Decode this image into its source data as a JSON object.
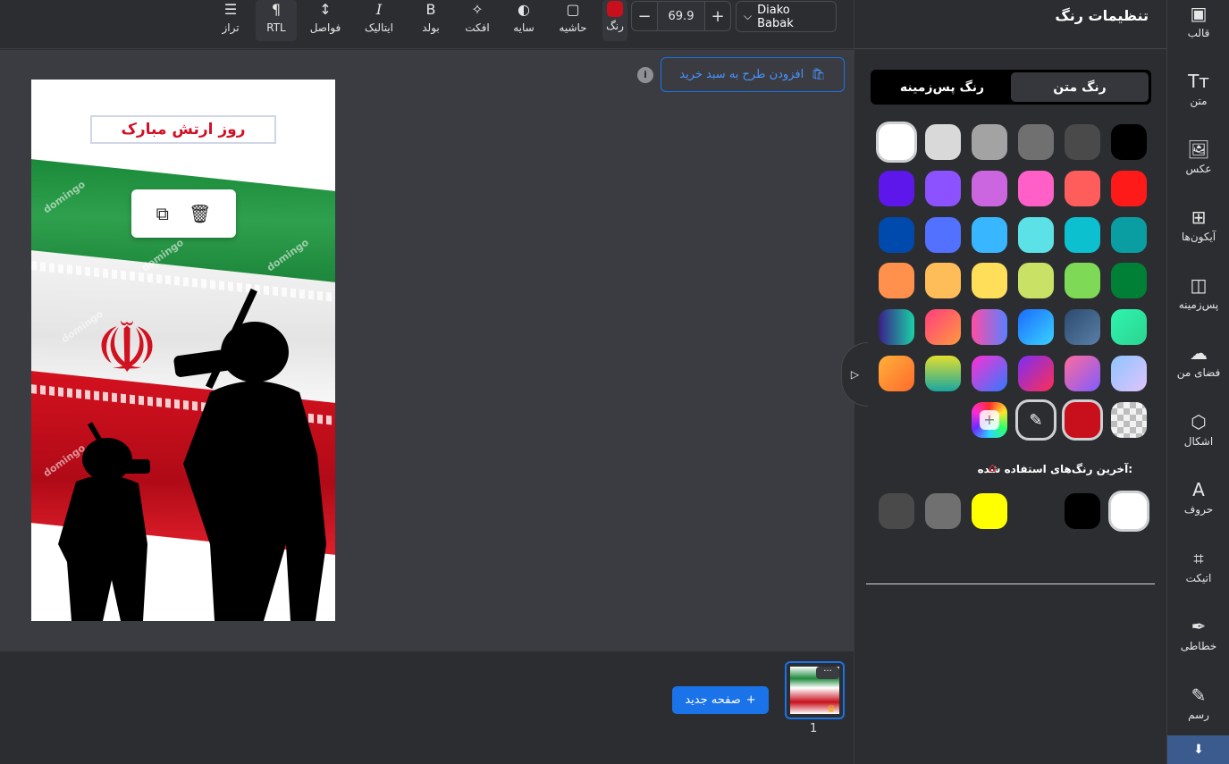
{
  "toolbar": {
    "align_label": "تراز",
    "rtl_label": "RTL",
    "spacing_label": "فواصل",
    "italic_label": "ایتالیک",
    "bold_label": "بولد",
    "effect_label": "افکت",
    "shadow_label": "سایه",
    "border_label": "حاشیه",
    "color_label": "رنگ",
    "zoom_value": "69.9",
    "zoom_minus": "−",
    "zoom_plus": "+",
    "font_name": "Diako Babak",
    "current_color": "#c8101d"
  },
  "canvas": {
    "add_to_cart_label": "افزودن طرح به سبد خرید",
    "info_symbol": "i",
    "poster_title": "روز ارتش مبارک",
    "watermark": "domingo"
  },
  "pages": {
    "new_page_label": "صفحه جدید",
    "page_number": "1",
    "thumb_more": "···"
  },
  "settings": {
    "title": "تنظیمات رنگ",
    "tab_text_color": "رنگ متن",
    "tab_bg_color": "رنگ پس‌زمینه",
    "recent_title": "آخرین رنگ‌های استفاده شده:"
  },
  "palette": [
    [
      "#000000",
      "#4a4a4a",
      "#707070",
      "#a3a3a3",
      "#d9d9d9",
      "#ffffff"
    ],
    [
      "#ff1a1a",
      "#ff5c5c",
      "#ff5fc6",
      "#cc66e0",
      "#8c52ff",
      "#5e17eb"
    ],
    [
      "#0a9ea3",
      "#0cc0cf",
      "#5ce1e6",
      "#38b6ff",
      "#5271ff",
      "#004aad"
    ],
    [
      "#008037",
      "#7ed957",
      "#c9e265",
      "#ffde59",
      "#ffbd59",
      "#ff914d"
    ]
  ],
  "recent_colors": [
    "#ffffff",
    "#000000",
    "#ffff00",
    "#707070",
    "#4a4a4a"
  ],
  "sidebar": {
    "items": [
      {
        "label": "قالب",
        "icon": "template-icon"
      },
      {
        "label": "متن",
        "icon": "text-icon"
      },
      {
        "label": "عکس",
        "icon": "image-icon"
      },
      {
        "label": "آیکون‌ها",
        "icon": "grid-icon"
      },
      {
        "label": "پس‌زمینه",
        "icon": "background-icon"
      },
      {
        "label": "فضای من",
        "icon": "cloud-upload-icon"
      },
      {
        "label": "اشکال",
        "icon": "shapes-icon"
      },
      {
        "label": "حروف",
        "icon": "letters-icon"
      },
      {
        "label": "اتیکت",
        "icon": "tag-icon"
      },
      {
        "label": "خطاطی",
        "icon": "feather-icon"
      },
      {
        "label": "رسم",
        "icon": "pen-icon"
      }
    ]
  }
}
